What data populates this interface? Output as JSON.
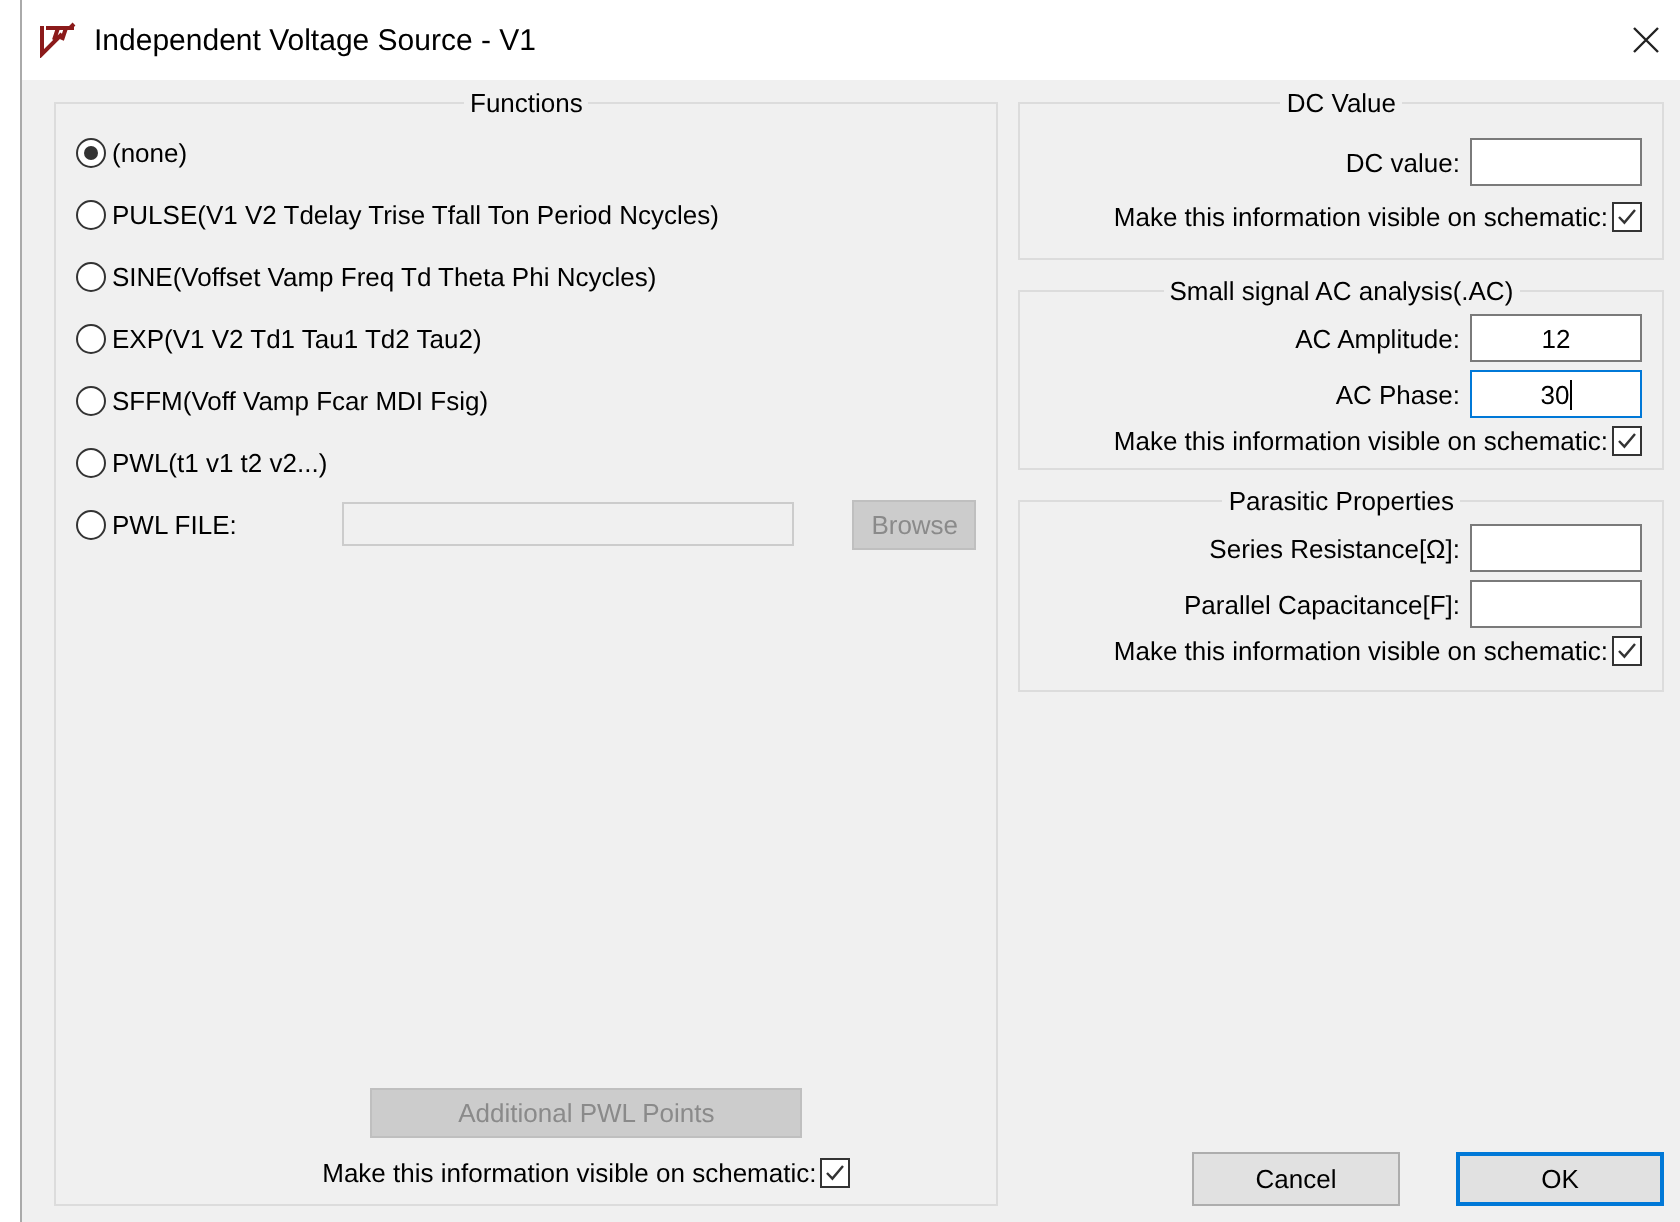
{
  "window": {
    "title": "Independent Voltage Source - V1"
  },
  "functions": {
    "title": "Functions",
    "options": [
      {
        "kind": "radio",
        "label": "(none)",
        "selected": true
      },
      {
        "kind": "radio",
        "label": "PULSE(V1 V2 Tdelay Trise Tfall Ton Period Ncycles)",
        "selected": false
      },
      {
        "kind": "radio",
        "label": "SINE(Voffset Vamp Freq Td Theta Phi Ncycles)",
        "selected": false
      },
      {
        "kind": "radio",
        "label": "EXP(V1 V2 Td1 Tau1 Td2 Tau2)",
        "selected": false
      },
      {
        "kind": "radio",
        "label": "SFFM(Voff Vamp Fcar MDI Fsig)",
        "selected": false
      },
      {
        "kind": "radio",
        "label": "PWL(t1 v1 t2 v2...)",
        "selected": false
      },
      {
        "kind": "file",
        "label": "PWL FILE:",
        "selected": false,
        "button": "Browse",
        "disabled": true
      }
    ],
    "additional_button": {
      "label": "Additional PWL Points",
      "disabled": true
    },
    "visible": {
      "label": "Make this information visible on schematic:",
      "checked": true
    }
  },
  "groups": [
    {
      "title": "DC Value",
      "fields": [
        {
          "label": "DC value:",
          "focused": false
        }
      ],
      "visible": {
        "label": "Make this information visible on schematic:",
        "checked": true
      }
    },
    {
      "title": "Small signal AC analysis(.AC)",
      "fields": [
        {
          "label": "AC Amplitude:",
          "value": "12",
          "focused": false
        },
        {
          "label": "AC Phase:",
          "value": "30",
          "focused": true
        }
      ],
      "visible": {
        "label": "Make this information visible on schematic:",
        "checked": true
      }
    },
    {
      "title": "Parasitic Properties",
      "fields": [
        {
          "label": "Series Resistance[Ω]:",
          "focused": false
        },
        {
          "label": "Parallel Capacitance[F]:",
          "focused": false
        }
      ],
      "visible": {
        "label": "Make this information visible on schematic:",
        "checked": true
      }
    }
  ],
  "buttons": [
    {
      "label": "Cancel",
      "default": false
    },
    {
      "label": "OK",
      "default": true
    }
  ]
}
